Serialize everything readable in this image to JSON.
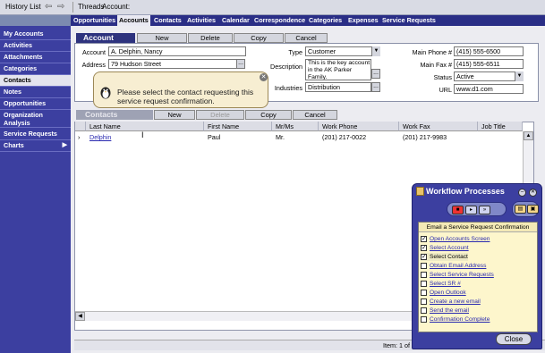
{
  "topbar": {
    "history_label": "History List",
    "threads_label": "Threads",
    "account_crumb": "Account:"
  },
  "nav": {
    "items": [
      "Opportunities",
      "Accounts",
      "Contacts",
      "Activities",
      "Calendar",
      "Correspondence",
      "Categories",
      "Expenses",
      "Service Requests"
    ],
    "active": "Accounts"
  },
  "sidebar": {
    "items": [
      "My Accounts",
      "Activities",
      "Attachments",
      "Categories",
      "Contacts",
      "Notes",
      "Opportunities",
      "Organization Analysis",
      "Service Requests",
      "Charts"
    ],
    "active": "Contacts"
  },
  "account": {
    "title": "Account",
    "buttons": [
      "New",
      "Delete",
      "Copy",
      "Cancel"
    ],
    "fields": {
      "account_label": "Account",
      "account_value": "A. Delphin, Nancy",
      "address_label": "Address",
      "address_value": "79 Hudson Street",
      "type_label": "Type",
      "type_value": "Customer",
      "description_label": "Description",
      "description_value": "This is the key account in the AK Parker Family.",
      "industries_label": "Industries",
      "industries_value": "Distribution",
      "main_phone_label": "Main Phone #",
      "main_phone_value": "(415) 555-6500",
      "main_fax_label": "Main Fax #",
      "main_fax_value": "(415) 555-6511",
      "status_label": "Status",
      "status_value": "Active",
      "url_label": "URL",
      "url_value": "www.d1.com"
    }
  },
  "balloon": {
    "message": "Please select the contact requesting this service request confirmation."
  },
  "contacts": {
    "title": "Contacts",
    "buttons": [
      "New",
      "Delete",
      "Copy",
      "Cancel"
    ],
    "columns": [
      "Last Name",
      "First Name",
      "Mr/Ms",
      "Work Phone",
      "Work Fax",
      "Job Title"
    ],
    "rows": [
      [
        "Delphin",
        "Paul",
        "Mr.",
        "(201) 217-0022",
        "(201) 217-9983",
        ""
      ]
    ],
    "status_text": "Item: 1 of"
  },
  "workflow": {
    "title": "Workflow Processes",
    "list_header": "Email a Service Request Confirmation",
    "items": [
      {
        "label": "Open Accounts Screen",
        "checked": true
      },
      {
        "label": "Select Account",
        "checked": true
      },
      {
        "label": "Select Contact",
        "checked": true
      },
      {
        "label": "Obtain Email Address",
        "checked": false
      },
      {
        "label": "Select Service Requests",
        "checked": false
      },
      {
        "label": "Select SR #",
        "checked": false
      },
      {
        "label": "Open Outlook",
        "checked": false
      },
      {
        "label": "Create a new email",
        "checked": false
      },
      {
        "label": "Send the email",
        "checked": false
      },
      {
        "label": "Confirmation Complete",
        "checked": false
      }
    ],
    "close_label": "Close"
  },
  "colors": {
    "nav_bg": "#2a2e86",
    "sidebar_bg": "#3c3fa0",
    "balloon_bg": "#f7eed2",
    "workflow_list_bg": "#fdf6cc",
    "link": "#2a2ab0"
  }
}
